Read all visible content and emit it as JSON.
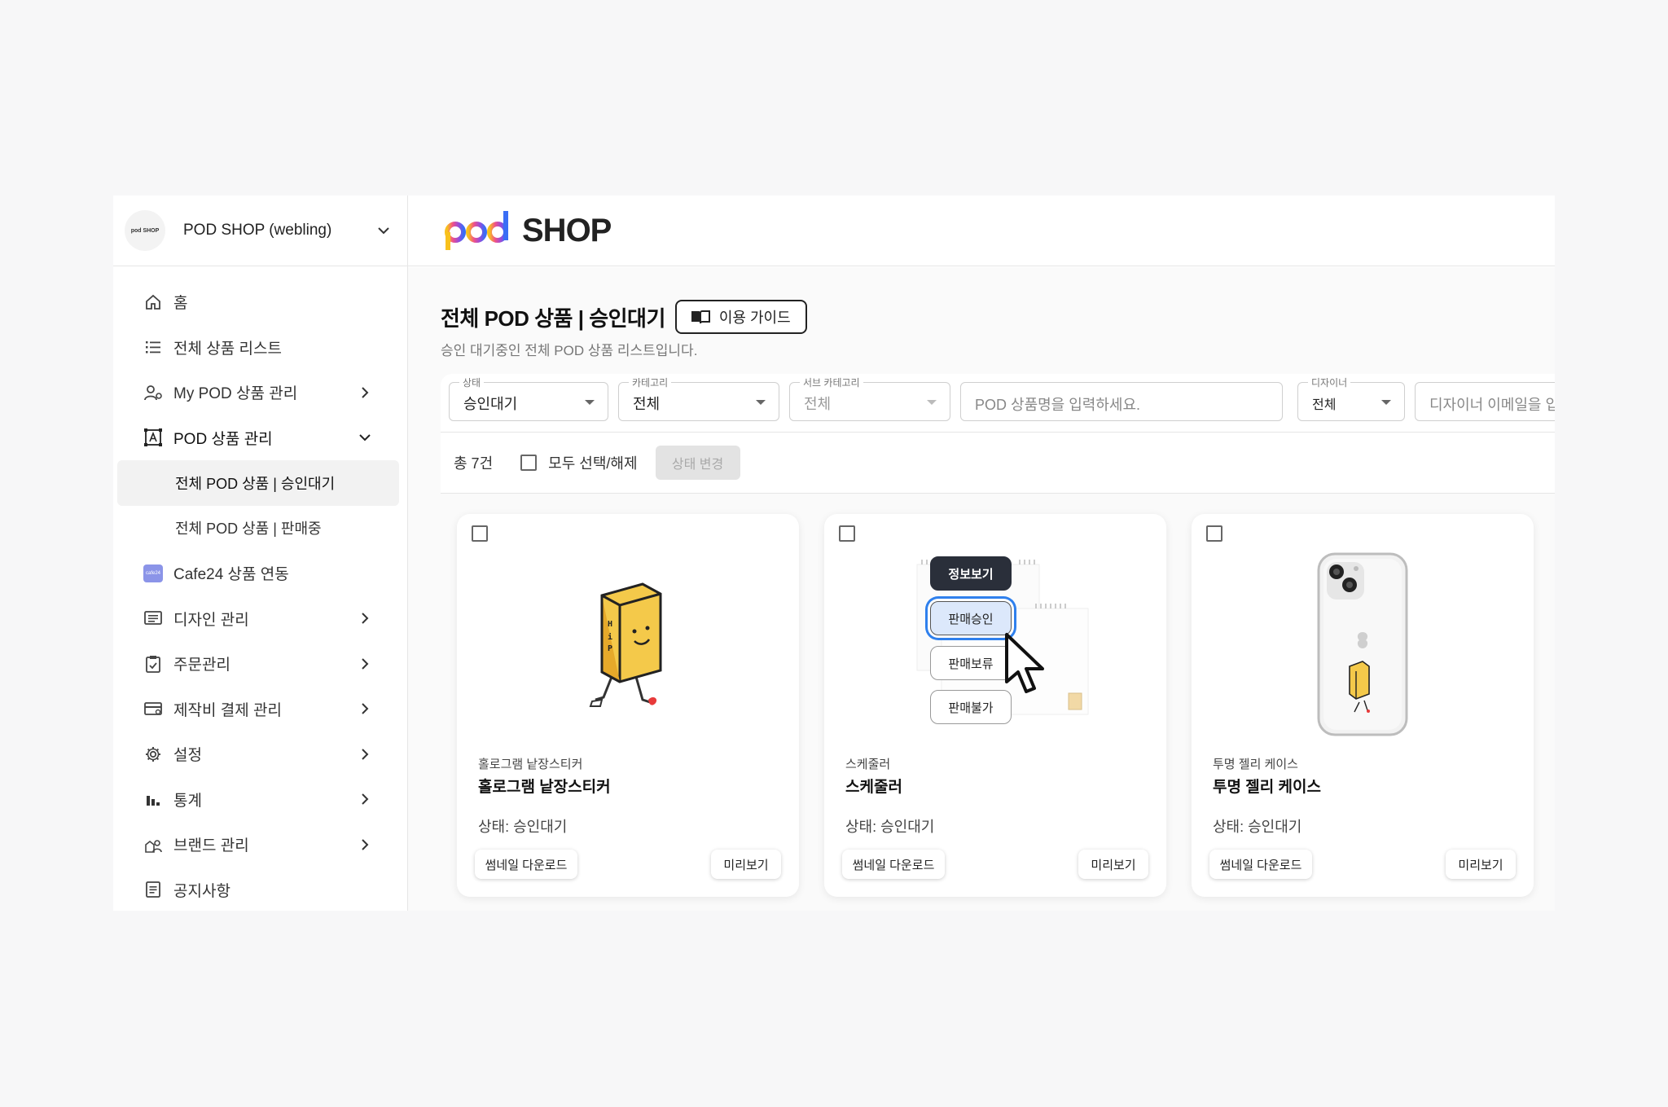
{
  "sidebar": {
    "shop_logo_text": "pod SHOP",
    "shop_name": "POD SHOP (webling)",
    "items": [
      {
        "label": "홈",
        "icon": "home-icon"
      },
      {
        "label": "전체 상품 리스트",
        "icon": "list-icon"
      },
      {
        "label": "My POD 상품 관리",
        "icon": "user-settings-icon"
      },
      {
        "label": "POD 상품 관리",
        "icon": "frame-a-icon"
      },
      {
        "label": "전체 POD 상품 | 승인대기"
      },
      {
        "label": "전체 POD 상품 | 판매중"
      },
      {
        "label": "Cafe24 상품 연동",
        "icon": "cafe24-icon"
      },
      {
        "label": "디자인 관리",
        "icon": "design-icon"
      },
      {
        "label": "주문관리",
        "icon": "clipboard-icon"
      },
      {
        "label": "제작비 결제 관리",
        "icon": "card-icon"
      },
      {
        "label": "설정",
        "icon": "gear-icon"
      },
      {
        "label": "통계",
        "icon": "bar-chart-icon"
      },
      {
        "label": "브랜드 관리",
        "icon": "brand-icon"
      },
      {
        "label": "공지사항",
        "icon": "notice-icon"
      }
    ],
    "cafe24_badge": "cafe24"
  },
  "header": {
    "logo_pod": "pod",
    "logo_shop": "SHOP"
  },
  "page": {
    "title": "전체 POD 상품 | 승인대기",
    "guide_button": "이용 가이드",
    "subtitle": "승인 대기중인 전체 POD 상품 리스트입니다."
  },
  "filters": {
    "status": {
      "label": "상태",
      "value": "승인대기"
    },
    "category": {
      "label": "카테고리",
      "value": "전체"
    },
    "subcategory": {
      "label": "서브 카테고리",
      "value": "전체"
    },
    "search": {
      "placeholder": "POD 상품명을 입력하세요."
    },
    "designer": {
      "label": "디자이너",
      "value": "전체"
    },
    "designer_email": {
      "placeholder": "디자이너 이메일을 입력"
    }
  },
  "actions": {
    "count": "총 7건",
    "select_all": "모두 선택/해제",
    "change_state": "상태 변경"
  },
  "cards": [
    {
      "category": "홀로그램 낱장스티커",
      "name": "홀로그램 낱장스티커",
      "status": "상태: 승인대기",
      "download": "썸네일 다운로드",
      "preview": "미리보기"
    },
    {
      "category": "스케줄러",
      "name": "스케줄러",
      "status": "상태: 승인대기",
      "download": "썸네일 다운로드",
      "preview": "미리보기"
    },
    {
      "category": "투명 젤리 케이스",
      "name": "투명 젤리 케이스",
      "status": "상태: 승인대기",
      "download": "썸네일 다운로드",
      "preview": "미리보기"
    }
  ],
  "popup_menu": {
    "info": "정보보기",
    "approve": "판매승인",
    "hold": "판매보류",
    "reject": "판매불가"
  },
  "colors": {
    "accent_blue": "#2f80ed",
    "dark_button": "#2a2f3a",
    "cafe24_badge": "#8b94e8"
  }
}
